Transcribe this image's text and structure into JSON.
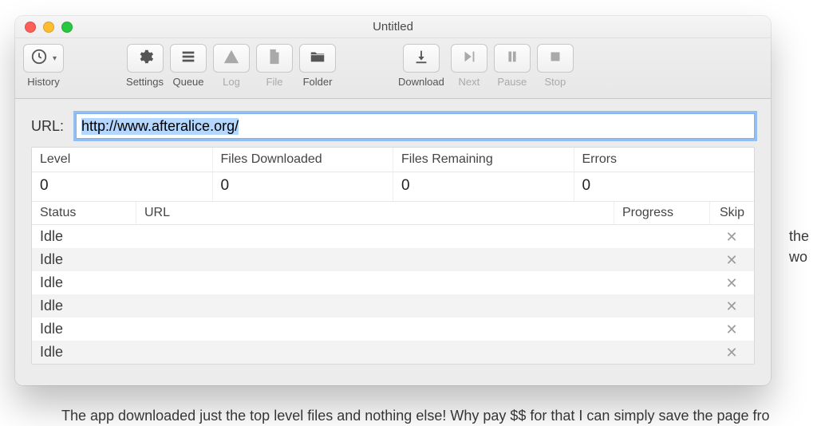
{
  "window": {
    "title": "Untitled"
  },
  "toolbar": {
    "history": "History",
    "settings": "Settings",
    "queue": "Queue",
    "log": "Log",
    "file": "File",
    "folder": "Folder",
    "download": "Download",
    "next": "Next",
    "pause": "Pause",
    "stop": "Stop"
  },
  "url": {
    "label": "URL:",
    "value": "http://www.afteralice.org/"
  },
  "stats": {
    "headers": {
      "level": "Level",
      "files_downloaded": "Files Downloaded",
      "files_remaining": "Files Remaining",
      "errors": "Errors"
    },
    "values": {
      "level": "0",
      "files_downloaded": "0",
      "files_remaining": "0",
      "errors": "0"
    }
  },
  "columns": {
    "status": "Status",
    "url": "URL",
    "progress": "Progress",
    "skip": "Skip"
  },
  "rows": [
    {
      "status": "Idle",
      "url": "",
      "progress": ""
    },
    {
      "status": "Idle",
      "url": "",
      "progress": ""
    },
    {
      "status": "Idle",
      "url": "",
      "progress": ""
    },
    {
      "status": "Idle",
      "url": "",
      "progress": ""
    },
    {
      "status": "Idle",
      "url": "",
      "progress": ""
    },
    {
      "status": "Idle",
      "url": "",
      "progress": ""
    }
  ],
  "background": {
    "right_fragment": " the\n wo",
    "bottom_fragment": "The app downloaded just the top level files and nothing else! Why pay $$ for that I can simply save the page fro"
  }
}
